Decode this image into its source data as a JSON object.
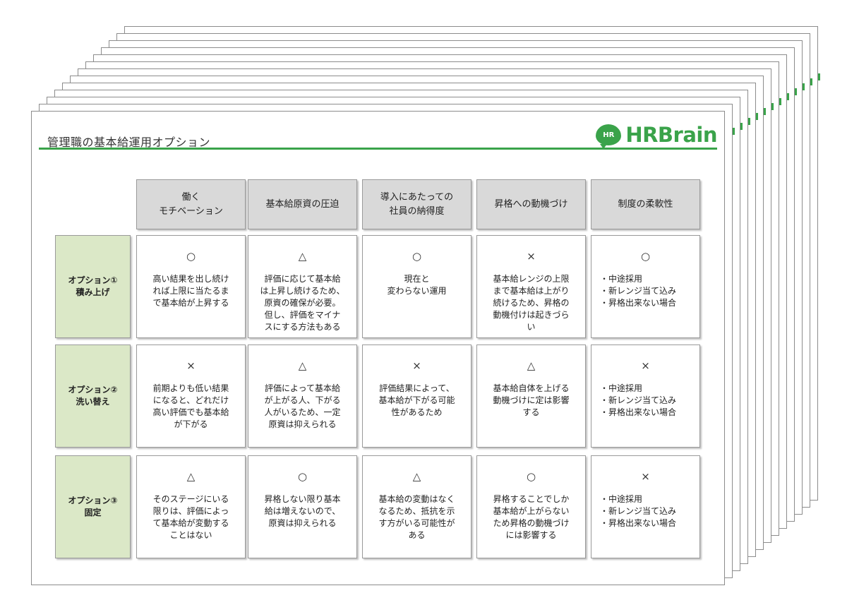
{
  "slide": {
    "title": "管理職の基本給運用オプション",
    "logo_badge": "HR",
    "logo_text": "HRBrain"
  },
  "columns": [
    "働く\nモチベーション",
    "基本給原資の圧迫",
    "導入にあたっての\n社員の納得度",
    "昇格への動機づけ",
    "制度の柔軟性"
  ],
  "rows": [
    {
      "label": "オプション①\n積み上げ",
      "cells": [
        {
          "mark": "○",
          "text": "高い結果を出し続け\nれば上限に当たるま\nで基本給が上昇する"
        },
        {
          "mark": "△",
          "text": "評価に応じて基本給\nは上昇し続けるため、\n原資の確保が必要。\n但し、評価をマイナ\nスにする方法もある"
        },
        {
          "mark": "○",
          "text": "現在と\n変わらない運用"
        },
        {
          "mark": "×",
          "text": "基本給レンジの上限\nまで基本給は上がり\n続けるため、昇格の\n動機付けは起きづら\nい"
        },
        {
          "mark": "○",
          "bullets": [
            "中途採用",
            "新レンジ当て込み",
            "昇格出来ない場合"
          ]
        }
      ]
    },
    {
      "label": "オプション②\n洗い替え",
      "cells": [
        {
          "mark": "×",
          "text": "前期よりも低い結果\nになると、どれだけ\n高い評価でも基本給\nが下がる"
        },
        {
          "mark": "△",
          "text": "評価によって基本給\nが上がる人、下がる\n人がいるため、一定\n原資は抑えられる"
        },
        {
          "mark": "×",
          "text": "評価結果によって、\n基本給が下がる可能\n性があるため"
        },
        {
          "mark": "△",
          "text": "基本給自体を上げる\n動機づけに定は影響\nする"
        },
        {
          "mark": "×",
          "bullets": [
            "中途採用",
            "新レンジ当て込み",
            "昇格出来ない場合"
          ]
        }
      ]
    },
    {
      "label": "オプション③\n固定",
      "cells": [
        {
          "mark": "△",
          "text": "そのステージにいる\n限りは、評価によっ\nて基本給が変動する\nことはない"
        },
        {
          "mark": "○",
          "text": "昇格しない限り基本\n給は増えないので、\n原資は抑えられる"
        },
        {
          "mark": "△",
          "text": "基本給の変動はなく\nなるため、抵抗を示\nす方がいる可能性が\nある"
        },
        {
          "mark": "○",
          "text": "昇格することでしか\n基本給が上がらない\nため昇格の動機づけ\nには影響する"
        },
        {
          "mark": "×",
          "bullets": [
            "中途採用",
            "新レンジ当て込み",
            "昇格出来ない場合"
          ]
        }
      ]
    }
  ],
  "colors": {
    "accent": "#3aa34a",
    "header_fill": "#d9d9d9",
    "row_header_fill": "#dbe8c7"
  }
}
